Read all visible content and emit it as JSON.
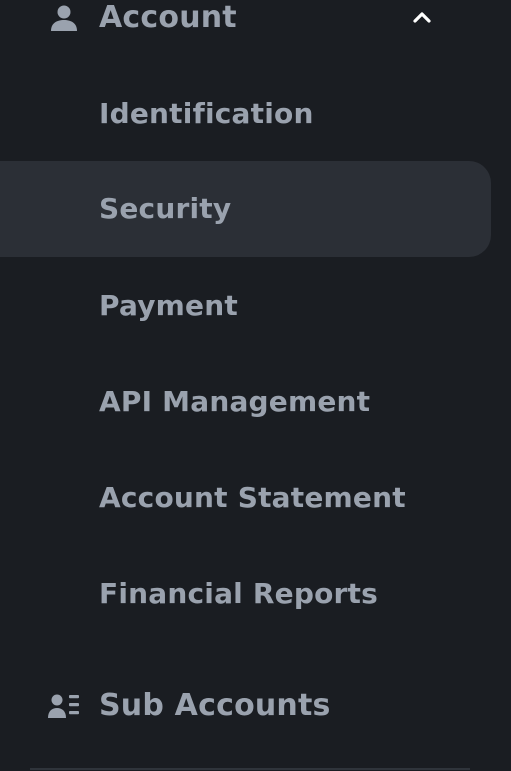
{
  "sidebar": {
    "account": {
      "icon": "user-icon",
      "label": "Account",
      "chevron": "chevron-up-icon",
      "expanded": true,
      "items": [
        {
          "label": "Identification",
          "active": false
        },
        {
          "label": "Security",
          "active": true
        },
        {
          "label": "Payment",
          "active": false
        },
        {
          "label": "API Management",
          "active": false
        },
        {
          "label": "Account Statement",
          "active": false
        },
        {
          "label": "Financial Reports",
          "active": false
        }
      ]
    },
    "sub_accounts": {
      "icon": "user-list-icon",
      "label": "Sub Accounts"
    }
  },
  "colors": {
    "background": "#1a1d22",
    "active_item_bg": "#2b2f36",
    "text": "#9aa2ae",
    "chevron": "#ffffff"
  }
}
